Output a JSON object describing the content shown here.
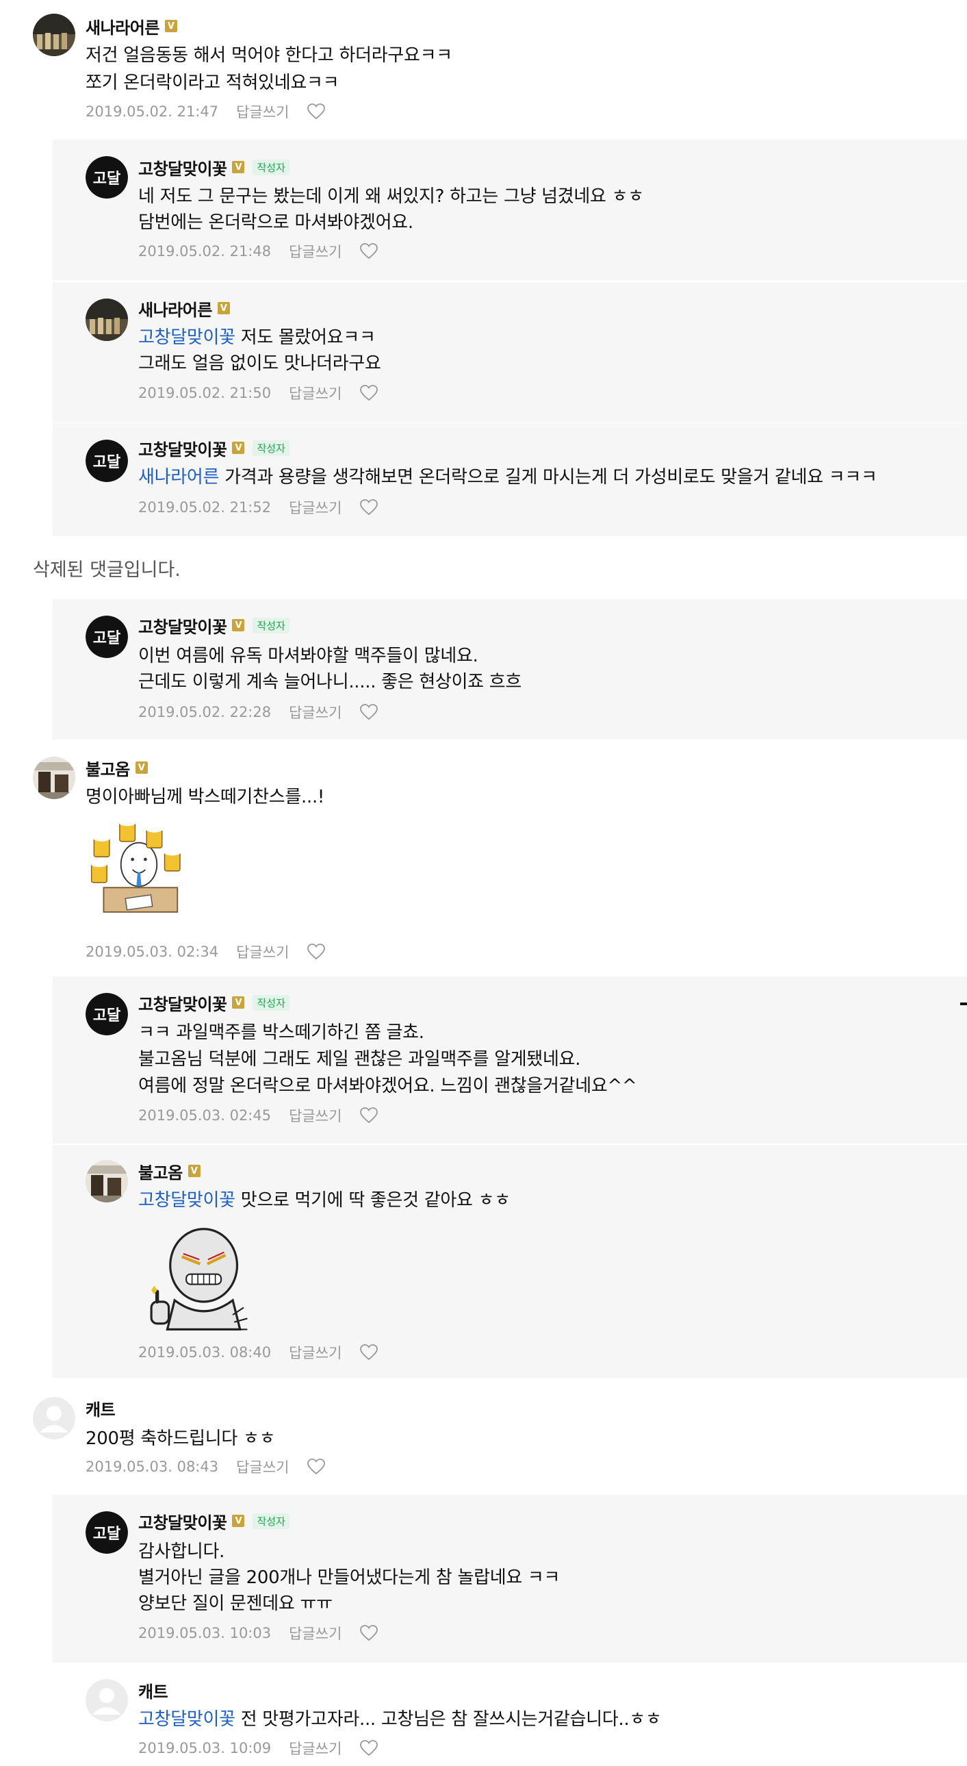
{
  "labels": {
    "reply": "답글쓰기",
    "author_badge": "작성자",
    "verified_badge": "V"
  },
  "deleted_comment": "삭제된 댓글입니다.",
  "comments": [
    {
      "author": "새나라어른",
      "lines": [
        {
          "text": "저건 얼음동동 해서 먹어야 한다고 하더라구요ㅋㅋ"
        },
        {
          "text": "쪼기 온더락이라고 적혀있네요ㅋㅋ"
        }
      ],
      "date": "2019.05.02. 21:47"
    },
    {
      "author": "고창달맞이꽃",
      "lines": [
        {
          "text": "네 저도 그 문구는 봤는데 이게 왜 써있지? 하고는 그냥 넘겼네요 ㅎㅎ"
        },
        {
          "text": "담번에는 온더락으로 마셔봐야겠어요."
        }
      ],
      "date": "2019.05.02. 21:48"
    },
    {
      "author": "새나라어른",
      "lines": [
        {
          "mention": "고창달맞이꽃",
          "text": "저도 몰랐어요ㅋㅋ"
        },
        {
          "text": "그래도 얼음 없이도 맛나더라구요"
        }
      ],
      "date": "2019.05.02. 21:50"
    },
    {
      "author": "고창달맞이꽃",
      "lines": [
        {
          "mention": "새나라어른",
          "text": "가격과 용량을 생각해보면 온더락으로 길게 마시는게 더 가성비로도 맞을거 같네요 ㅋㅋㅋ"
        }
      ],
      "date": "2019.05.02. 21:52"
    },
    {
      "author": "고창달맞이꽃",
      "lines": [
        {
          "text": "이번 여름에 유독 마셔봐야할 맥주들이 많네요."
        },
        {
          "text": "근데도 이렇게 계속 늘어나니..... 좋은 현상이죠 흐흐"
        }
      ],
      "date": "2019.05.02. 22:28"
    },
    {
      "author": "불고옴",
      "lines": [
        {
          "text": "명이아빠님께 박스떼기찬스를...!"
        }
      ],
      "date": "2019.05.03. 02:34"
    },
    {
      "author": "고창달맞이꽃",
      "lines": [
        {
          "text": "ㅋㅋ 과일맥주를 박스떼기하긴 쫌 글쵸."
        },
        {
          "text": "불고옴님 덕분에 그래도 제일 괜찮은 과일맥주를 알게됐네요."
        },
        {
          "text": "여름에 정말 온더락으로 마셔봐야겠어요. 느낌이 괜찮을거같네요^^"
        }
      ],
      "date": "2019.05.03. 02:45"
    },
    {
      "author": "불고옴",
      "lines": [
        {
          "mention": "고창달맞이꽃",
          "text": "맛으로 먹기에 딱 좋은것 같아요 ㅎㅎ"
        }
      ],
      "date": "2019.05.03. 08:40"
    },
    {
      "author": "캐트",
      "lines": [
        {
          "text": "200평 축하드립니다 ㅎㅎ"
        }
      ],
      "date": "2019.05.03. 08:43"
    },
    {
      "author": "고창달맞이꽃",
      "lines": [
        {
          "text": "감사합니다."
        },
        {
          "text": "별거아닌 글을 200개나 만들어냈다는게 참 놀랍네요 ㅋㅋ"
        },
        {
          "text": "양보단 질이 문젠데요 ㅠㅠ"
        }
      ],
      "date": "2019.05.03. 10:03"
    },
    {
      "author": "캐트",
      "lines": [
        {
          "mention": "고창달맞이꽃",
          "text": "전 맛평가고자라... 고창님은 참 잘쓰시는거같습니다..ㅎㅎ"
        }
      ],
      "date": "2019.05.03. 10:09"
    }
  ]
}
